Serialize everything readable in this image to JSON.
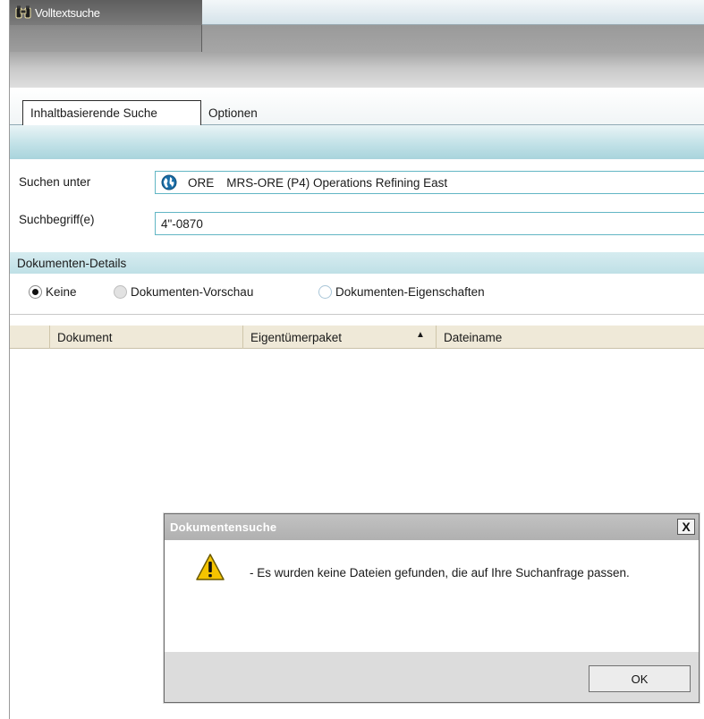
{
  "window": {
    "title": "Volltextsuche"
  },
  "tabs": [
    {
      "label": "Inhaltbasierende Suche",
      "active": true
    },
    {
      "label": "Optionen",
      "active": false
    }
  ],
  "form": {
    "scope_label": "Suchen unter",
    "scope_code": "ORE",
    "scope_name": "MRS-ORE (P4) Operations Refining East",
    "term_label": "Suchbegriff(e)",
    "term_value": "4\"-0870"
  },
  "details": {
    "header": "Dokumenten-Details",
    "options": [
      {
        "label": "Keine",
        "checked": true
      },
      {
        "label": "Dokumenten-Vorschau",
        "checked": false
      },
      {
        "label": "Dokumenten-Eigenschaften",
        "checked": false
      }
    ]
  },
  "grid": {
    "columns": [
      "Dokument",
      "Eigentümerpaket",
      "Dateiname"
    ],
    "sort_indicator": "▲",
    "rows": []
  },
  "dialog": {
    "title": "Dokumentensuche",
    "close_label": "X",
    "message": "- Es wurden keine Dateien gefunden, die auf Ihre Suchanfrage passen.",
    "ok_label": "OK"
  },
  "colors": {
    "accent_teal": "#62b6c4",
    "grid_header": "#efe9d8",
    "warning_yellow": "#f5c400"
  }
}
